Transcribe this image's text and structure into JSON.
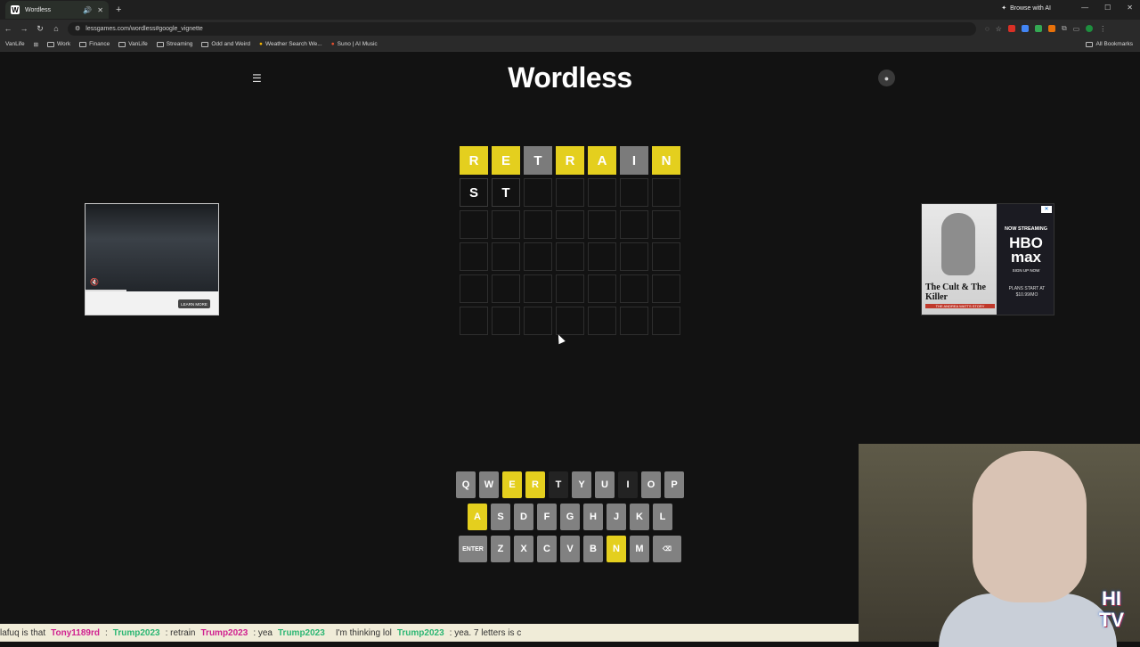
{
  "browser": {
    "tab_title": "Wordless",
    "browse_ai": "Browse with AI",
    "url": "lessgames.com/wordless#google_vignette",
    "bookmarks": [
      "VanLife",
      "Work",
      "Finance",
      "VanLife",
      "Streaming",
      "Odd and Weird",
      "Weather Search We...",
      "Suno | AI Music"
    ],
    "all_bookmarks": "All Bookmarks"
  },
  "game": {
    "title": "Wordless",
    "rows": [
      [
        {
          "l": "R",
          "s": "y"
        },
        {
          "l": "E",
          "s": "y"
        },
        {
          "l": "T",
          "s": "g"
        },
        {
          "l": "R",
          "s": "y"
        },
        {
          "l": "A",
          "s": "y"
        },
        {
          "l": "I",
          "s": "g"
        },
        {
          "l": "N",
          "s": "y"
        }
      ],
      [
        {
          "l": "S",
          "s": "t"
        },
        {
          "l": "T",
          "s": "t"
        },
        {
          "l": "",
          "s": ""
        },
        {
          "l": "",
          "s": ""
        },
        {
          "l": "",
          "s": ""
        },
        {
          "l": "",
          "s": ""
        },
        {
          "l": "",
          "s": ""
        }
      ],
      [
        {
          "l": "",
          "s": ""
        },
        {
          "l": "",
          "s": ""
        },
        {
          "l": "",
          "s": ""
        },
        {
          "l": "",
          "s": ""
        },
        {
          "l": "",
          "s": ""
        },
        {
          "l": "",
          "s": ""
        },
        {
          "l": "",
          "s": ""
        }
      ],
      [
        {
          "l": "",
          "s": ""
        },
        {
          "l": "",
          "s": ""
        },
        {
          "l": "",
          "s": ""
        },
        {
          "l": "",
          "s": ""
        },
        {
          "l": "",
          "s": ""
        },
        {
          "l": "",
          "s": ""
        },
        {
          "l": "",
          "s": ""
        }
      ],
      [
        {
          "l": "",
          "s": ""
        },
        {
          "l": "",
          "s": ""
        },
        {
          "l": "",
          "s": ""
        },
        {
          "l": "",
          "s": ""
        },
        {
          "l": "",
          "s": ""
        },
        {
          "l": "",
          "s": ""
        },
        {
          "l": "",
          "s": ""
        }
      ],
      [
        {
          "l": "",
          "s": ""
        },
        {
          "l": "",
          "s": ""
        },
        {
          "l": "",
          "s": ""
        },
        {
          "l": "",
          "s": ""
        },
        {
          "l": "",
          "s": ""
        },
        {
          "l": "",
          "s": ""
        },
        {
          "l": "",
          "s": ""
        }
      ]
    ],
    "keyboard": [
      [
        {
          "k": "Q",
          "s": ""
        },
        {
          "k": "W",
          "s": ""
        },
        {
          "k": "E",
          "s": "y"
        },
        {
          "k": "R",
          "s": "y"
        },
        {
          "k": "T",
          "s": "d"
        },
        {
          "k": "Y",
          "s": ""
        },
        {
          "k": "U",
          "s": ""
        },
        {
          "k": "I",
          "s": "d"
        },
        {
          "k": "O",
          "s": ""
        },
        {
          "k": "P",
          "s": ""
        }
      ],
      [
        {
          "k": "A",
          "s": "y"
        },
        {
          "k": "S",
          "s": ""
        },
        {
          "k": "D",
          "s": ""
        },
        {
          "k": "F",
          "s": ""
        },
        {
          "k": "G",
          "s": ""
        },
        {
          "k": "H",
          "s": ""
        },
        {
          "k": "J",
          "s": ""
        },
        {
          "k": "K",
          "s": ""
        },
        {
          "k": "L",
          "s": ""
        }
      ],
      [
        {
          "k": "ENTER",
          "s": "wide"
        },
        {
          "k": "Z",
          "s": ""
        },
        {
          "k": "X",
          "s": ""
        },
        {
          "k": "C",
          "s": ""
        },
        {
          "k": "V",
          "s": ""
        },
        {
          "k": "B",
          "s": ""
        },
        {
          "k": "N",
          "s": "y"
        },
        {
          "k": "M",
          "s": ""
        },
        {
          "k": "⌫",
          "s": "wide"
        }
      ]
    ]
  },
  "ads": {
    "left_button": "LEARN MORE",
    "right_title": "The Cult & The Killer",
    "right_sub": "THE ANDREA WATTS STORY",
    "right_now": "NOW STREAMING",
    "right_brand": "HBO max",
    "right_signup": "SIGN UP NOW",
    "right_plans": "PLANS START AT $10.99/MO"
  },
  "ticker": [
    {
      "u": "",
      "m": "lafuq is that"
    },
    {
      "u": "Tony1189rd",
      "m": ":"
    },
    {
      "u": "Trump2023",
      "m": ": retrain"
    },
    {
      "u": "Trump2023",
      "m": ": yea"
    },
    {
      "u": "Trump2023",
      "m": ""
    },
    {
      "u": "",
      "m": "I'm thinking lol"
    },
    {
      "u": "Trump2023",
      "m": ": yea. 7 letters is c"
    }
  ]
}
